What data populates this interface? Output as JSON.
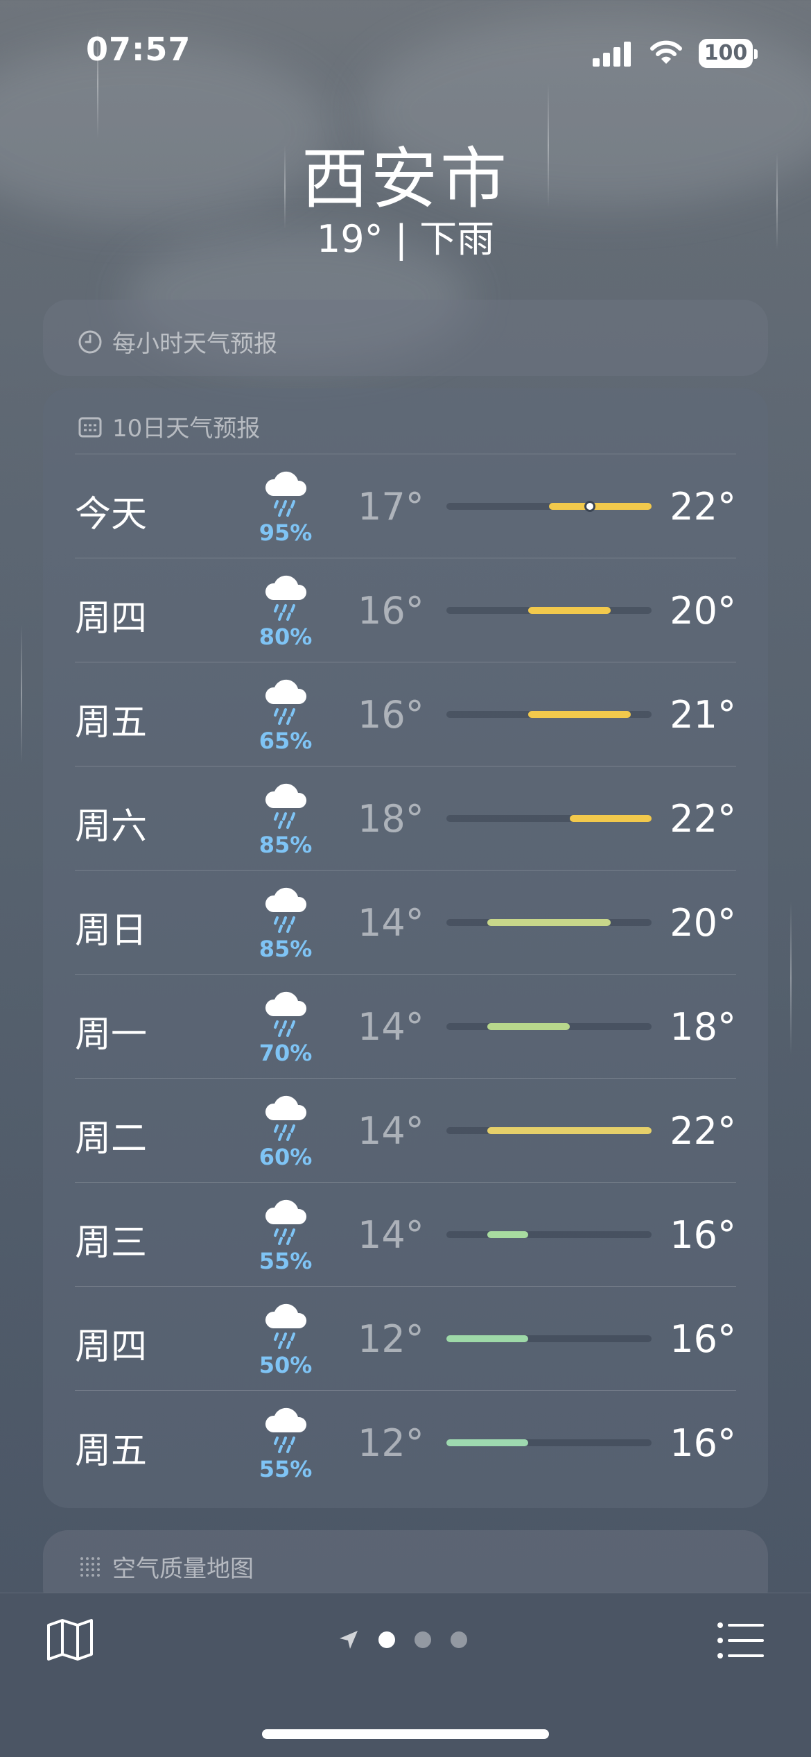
{
  "status": {
    "time": "07:57",
    "battery": "100"
  },
  "location": {
    "city": "西安市",
    "summary": "19° | 下雨"
  },
  "hourly": {
    "title": "每小时天气预报"
  },
  "forecast": {
    "title": "10日天气预报",
    "range_min": 12,
    "range_max": 22,
    "days": [
      {
        "day": "今天",
        "pct": "95%",
        "low": "17°",
        "high": "22°",
        "low_v": 17,
        "high_v": 22,
        "color": "#f2c94c",
        "current": 19
      },
      {
        "day": "周四",
        "pct": "80%",
        "low": "16°",
        "high": "20°",
        "low_v": 16,
        "high_v": 20,
        "color": "#f2c94c"
      },
      {
        "day": "周五",
        "pct": "65%",
        "low": "16°",
        "high": "21°",
        "low_v": 16,
        "high_v": 21,
        "color": "#f2c94c"
      },
      {
        "day": "周六",
        "pct": "85%",
        "low": "18°",
        "high": "22°",
        "low_v": 18,
        "high_v": 22,
        "color": "#f2c94c"
      },
      {
        "day": "周日",
        "pct": "85%",
        "low": "14°",
        "high": "20°",
        "low_v": 14,
        "high_v": 20,
        "color": "#c8d78a"
      },
      {
        "day": "周一",
        "pct": "70%",
        "low": "14°",
        "high": "18°",
        "low_v": 14,
        "high_v": 18,
        "color": "#b8d88c"
      },
      {
        "day": "周二",
        "pct": "60%",
        "low": "14°",
        "high": "22°",
        "low_v": 14,
        "high_v": 22,
        "color": "#e6d06a"
      },
      {
        "day": "周三",
        "pct": "55%",
        "low": "14°",
        "high": "16°",
        "low_v": 14,
        "high_v": 16,
        "color": "#a8dca0"
      },
      {
        "day": "周四",
        "pct": "50%",
        "low": "12°",
        "high": "16°",
        "low_v": 12,
        "high_v": 16,
        "color": "#9ed9a8"
      },
      {
        "day": "周五",
        "pct": "55%",
        "low": "12°",
        "high": "16°",
        "low_v": 12,
        "high_v": 16,
        "color": "#9ed9b0"
      }
    ]
  },
  "aqi": {
    "title": "空气质量地图"
  },
  "icons": {
    "weather": "cloud-rain-icon",
    "map": "map-icon",
    "list": "list-icon",
    "location": "location-arrow-icon"
  }
}
